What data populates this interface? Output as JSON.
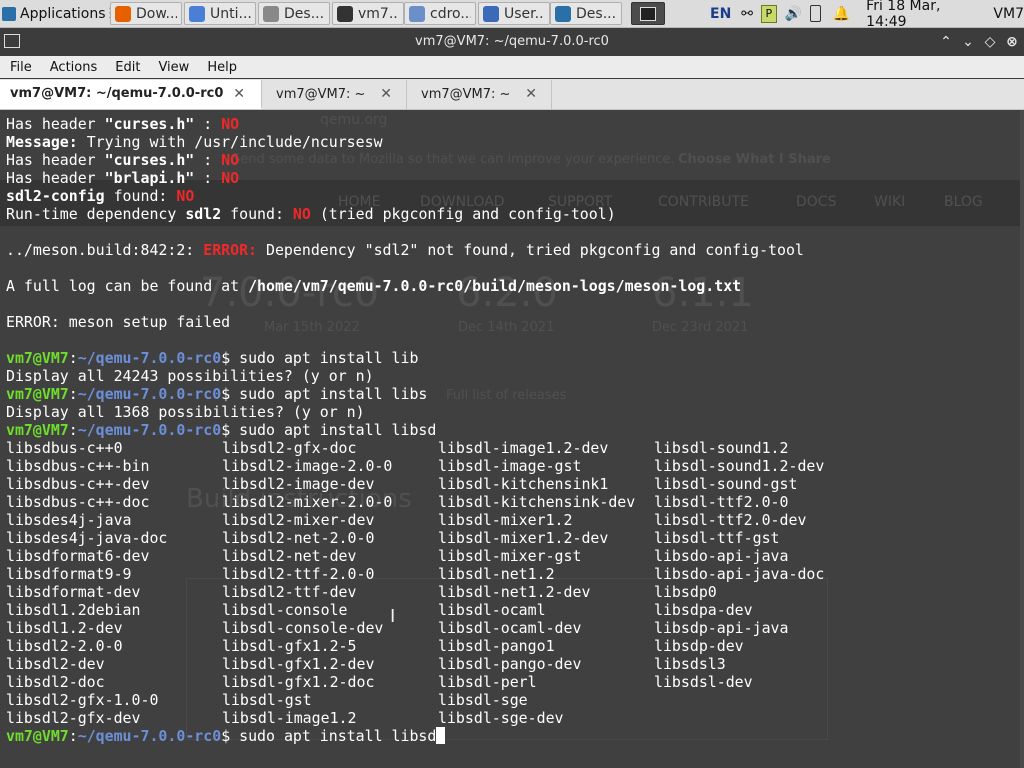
{
  "taskbar": {
    "applications_label": "Applications",
    "tasks": [
      {
        "label": "Dow...",
        "icon": "firefox-icon",
        "color": "#e66000"
      },
      {
        "label": "Unti...",
        "icon": "chromium-icon",
        "color": "#4a7fd6"
      },
      {
        "label": "Des...",
        "icon": "document-icon",
        "color": "#888888"
      },
      {
        "label": "vm7...",
        "icon": "terminal-icon",
        "color": "#333333"
      },
      {
        "label": "cdro...",
        "icon": "folder-icon",
        "color": "#6b8fc8"
      },
      {
        "label": "User...",
        "icon": "settings-icon",
        "color": "#3a6ab8"
      },
      {
        "label": "Des...",
        "icon": "desktop-icon",
        "color": "#2a6fa8"
      }
    ],
    "language": "EN",
    "datetime": "Fri 18 Mar, 14:49",
    "hostname": "VM7"
  },
  "window": {
    "title": "vm7@VM7: ~/qemu-7.0.0-rc0"
  },
  "menu": [
    "File",
    "Actions",
    "Edit",
    "View",
    "Help"
  ],
  "tabs": [
    {
      "label": "vm7@VM7: ~/qemu-7.0.0-rc0",
      "active": true
    },
    {
      "label": "vm7@VM7: ~",
      "active": false
    },
    {
      "label": "vm7@VM7: ~",
      "active": false
    }
  ],
  "background_page": {
    "url": "qemu.org",
    "notice": "Send some data to Mozilla so that we can improve your experience.",
    "notice_button": "Choose What I Share",
    "nav": [
      "HOME",
      "DOWNLOAD",
      "SUPPORT",
      "CONTRIBUTE",
      "DOCS",
      "WIKI",
      "BLOG"
    ],
    "versions": [
      "7.0.0-rc0",
      "6.2.0",
      "6.1.1"
    ],
    "dates": [
      "Mar 15th 2022",
      "Dec 14th 2021",
      "Dec 23rd 2021"
    ],
    "full_list": "Full list of releases",
    "heading": "Build instructions"
  },
  "terminal": {
    "prompt": {
      "user": "vm7@VM7",
      "path": "~/qemu-7.0.0-rc0"
    },
    "pre_lines": [
      [
        {
          "t": "Has header "
        },
        {
          "t": "\"curses.h\"",
          "c": "bold"
        },
        {
          "t": " : "
        },
        {
          "t": "NO",
          "c": "red"
        }
      ],
      [
        {
          "t": "Message:",
          "c": "bold"
        },
        {
          "t": " Trying with /usr/include/ncursesw"
        }
      ],
      [
        {
          "t": "Has header "
        },
        {
          "t": "\"curses.h\"",
          "c": "bold"
        },
        {
          "t": " : "
        },
        {
          "t": "NO",
          "c": "red"
        }
      ],
      [
        {
          "t": "Has header "
        },
        {
          "t": "\"brlapi.h\"",
          "c": "bold"
        },
        {
          "t": " : "
        },
        {
          "t": "NO",
          "c": "red"
        }
      ],
      [
        {
          "t": "sdl2-config",
          "c": "bold"
        },
        {
          "t": " found: "
        },
        {
          "t": "NO",
          "c": "red"
        }
      ],
      [
        {
          "t": "Run-time dependency "
        },
        {
          "t": "sdl2",
          "c": "bold"
        },
        {
          "t": " found: "
        },
        {
          "t": "NO",
          "c": "red"
        },
        {
          "t": " (tried pkgconfig and config-tool)"
        }
      ],
      [],
      [
        {
          "t": "../meson.build:842:2: "
        },
        {
          "t": "ERROR:",
          "c": "red"
        },
        {
          "t": " Dependency \"sdl2\" not found, tried pkgconfig and config-tool"
        }
      ],
      [],
      [
        {
          "t": "A full log can be found at "
        },
        {
          "t": "/home/vm7/qemu-7.0.0-rc0/build/meson-logs/meson-log.txt",
          "c": "bold"
        }
      ],
      [],
      [
        {
          "t": "ERROR: meson setup failed"
        }
      ],
      [],
      [
        {
          "p": true
        },
        {
          "t": " sudo apt install lib"
        }
      ],
      [
        {
          "t": "Display all 24243 possibilities? (y or n)"
        }
      ],
      [
        {
          "p": true
        },
        {
          "t": " sudo apt install libs"
        }
      ],
      [
        {
          "t": "Display all 1368 possibilities? (y or n)"
        }
      ],
      [
        {
          "p": true
        },
        {
          "t": " sudo apt install libsd"
        }
      ]
    ],
    "completion_rows": [
      [
        "libsdbus-c++0",
        "libsdl2-gfx-doc",
        "libsdl-image1.2-dev",
        "libsdl-sound1.2"
      ],
      [
        "libsdbus-c++-bin",
        "libsdl2-image-2.0-0",
        "libsdl-image-gst",
        "libsdl-sound1.2-dev"
      ],
      [
        "libsdbus-c++-dev",
        "libsdl2-image-dev",
        "libsdl-kitchensink1",
        "libsdl-sound-gst"
      ],
      [
        "libsdbus-c++-doc",
        "libsdl2-mixer-2.0-0",
        "libsdl-kitchensink-dev",
        "libsdl-ttf2.0-0"
      ],
      [
        "libsdes4j-java",
        "libsdl2-mixer-dev",
        "libsdl-mixer1.2",
        "libsdl-ttf2.0-dev"
      ],
      [
        "libsdes4j-java-doc",
        "libsdl2-net-2.0-0",
        "libsdl-mixer1.2-dev",
        "libsdl-ttf-gst"
      ],
      [
        "libsdformat6-dev",
        "libsdl2-net-dev",
        "libsdl-mixer-gst",
        "libsdo-api-java"
      ],
      [
        "libsdformat9-9",
        "libsdl2-ttf-2.0-0",
        "libsdl-net1.2",
        "libsdo-api-java-doc"
      ],
      [
        "libsdformat-dev",
        "libsdl2-ttf-dev",
        "libsdl-net1.2-dev",
        "libsdp0"
      ],
      [
        "libsdl1.2debian",
        "libsdl-console",
        "libsdl-ocaml",
        "libsdpa-dev"
      ],
      [
        "libsdl1.2-dev",
        "libsdl-console-dev",
        "libsdl-ocaml-dev",
        "libsdp-api-java"
      ],
      [
        "libsdl2-2.0-0",
        "libsdl-gfx1.2-5",
        "libsdl-pango1",
        "libsdp-dev"
      ],
      [
        "libsdl2-dev",
        "libsdl-gfx1.2-dev",
        "libsdl-pango-dev",
        "libsdsl3"
      ],
      [
        "libsdl2-doc",
        "libsdl-gfx1.2-doc",
        "libsdl-perl",
        "libsdsl-dev"
      ],
      [
        "libsdl2-gfx-1.0-0",
        "libsdl-gst",
        "libsdl-sge",
        ""
      ],
      [
        "libsdl2-gfx-dev",
        "libsdl-image1.2",
        "libsdl-sge-dev",
        ""
      ]
    ],
    "current_command": " sudo apt install libsd"
  }
}
